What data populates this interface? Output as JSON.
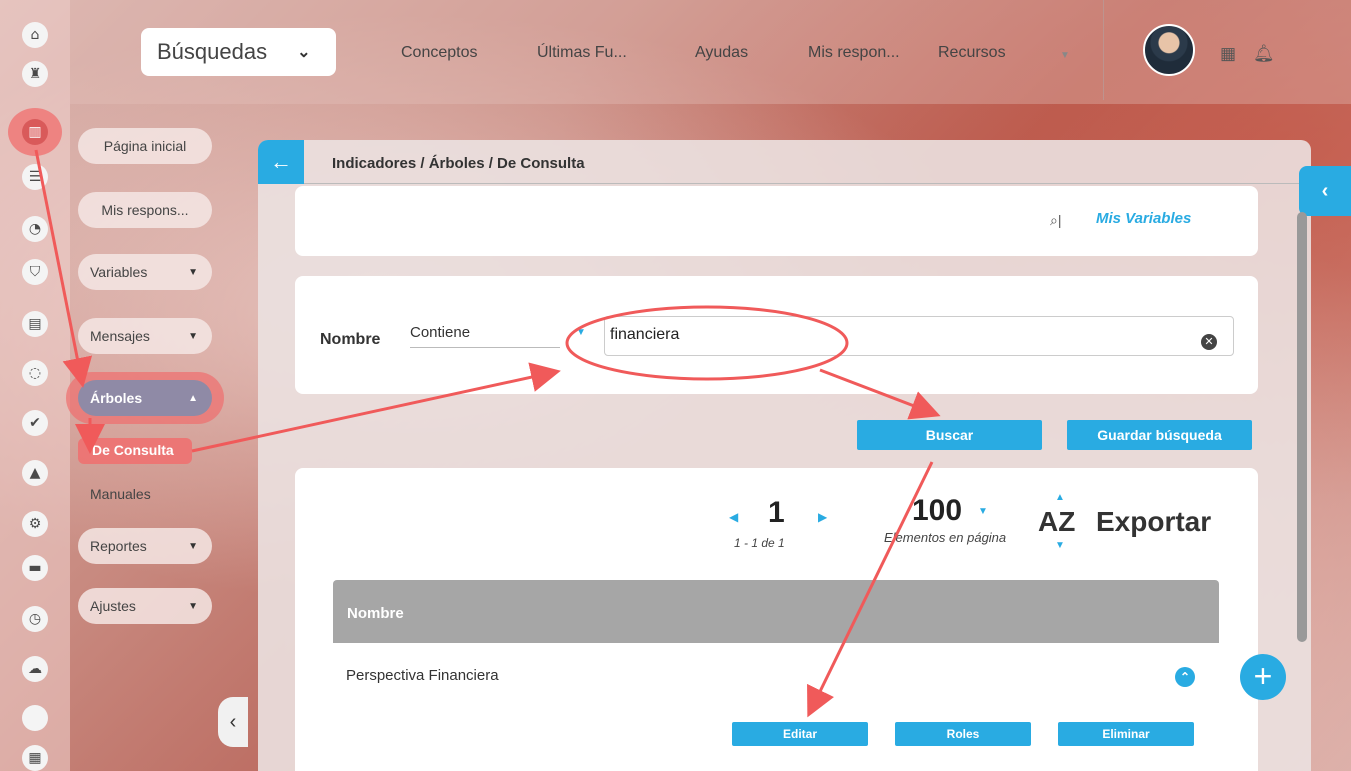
{
  "header": {
    "search_select": "Búsquedas",
    "nav": [
      "Conceptos",
      "Últimas Fu...",
      "Ayudas",
      "Mis respon...",
      "Recursos"
    ]
  },
  "rail_icons": [
    "home-icon",
    "chess-rook-icon",
    "bar-chart-icon",
    "strategy-icon",
    "pie-chart-icon",
    "shield-icon",
    "document-icon",
    "cycle-icon",
    "check-icon",
    "warning-icon",
    "gears-icon",
    "presentation-icon",
    "clock-icon",
    "cloud-icon",
    "blank-icon",
    "calendar-icon"
  ],
  "menu": {
    "items": [
      {
        "label": "Página inicial"
      },
      {
        "label": "Mis respons..."
      },
      {
        "label": "Variables"
      },
      {
        "label": "Mensajes"
      },
      {
        "label": "Árboles"
      },
      {
        "label": "Reportes"
      },
      {
        "label": "Ajustes"
      }
    ],
    "submenu": [
      "De Consulta",
      "Manuales"
    ]
  },
  "breadcrumb": "Indicadores / Árboles / De Consulta",
  "my_variables": "Mis Variables",
  "filter": {
    "field_label": "Nombre",
    "operator": "Contiene",
    "value": "financiera"
  },
  "buttons": {
    "search": "Buscar",
    "save_search": "Guardar búsqueda"
  },
  "pager": {
    "page": "1",
    "range": "1 - 1 de 1",
    "per_page": "100",
    "per_page_label": "Elementos en página",
    "sort": "AZ",
    "export": "Exportar"
  },
  "table": {
    "header": "Nombre",
    "rows": [
      {
        "name": "Perspectiva Financiera",
        "actions": [
          "Editar",
          "Roles",
          "Eliminar"
        ]
      }
    ]
  },
  "colors": {
    "accent": "#29abe2",
    "annotation": "#f05a5a"
  }
}
